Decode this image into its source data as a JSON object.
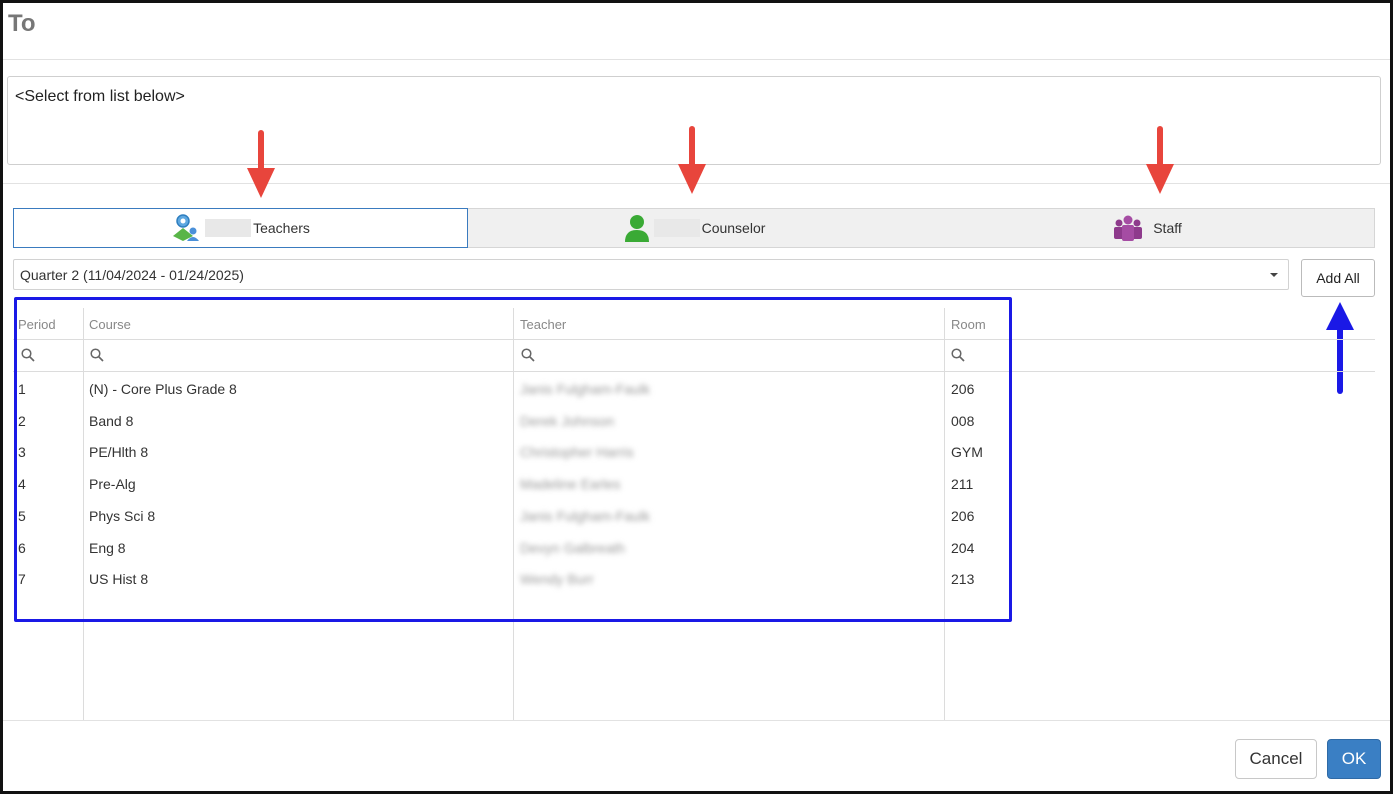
{
  "dialog": {
    "title": "To",
    "recipients_placeholder": "<Select from list below>"
  },
  "tabs": [
    {
      "label": "Teachers",
      "icon": "teachers-icon",
      "active": true
    },
    {
      "label": "Counselor",
      "icon": "counselor-icon",
      "active": false
    },
    {
      "label": "Staff",
      "icon": "staff-icon",
      "active": false
    }
  ],
  "term_select": {
    "value": "Quarter 2 (11/04/2024 - 01/24/2025)"
  },
  "add_all_label": "Add All",
  "table": {
    "columns": [
      "Period",
      "Course",
      "Teacher",
      "Room"
    ],
    "rows": [
      {
        "period": "1",
        "course": "(N) - Core Plus Grade 8",
        "teacher": "Janis Fulgham-Faulk",
        "room": "206"
      },
      {
        "period": "2",
        "course": "Band 8",
        "teacher": "Derek Johnson",
        "room": "008"
      },
      {
        "period": "3",
        "course": "PE/Hlth 8",
        "teacher": "Christopher Harris",
        "room": "GYM"
      },
      {
        "period": "4",
        "course": "Pre-Alg",
        "teacher": "Madeline Earles",
        "room": "211"
      },
      {
        "period": "5",
        "course": "Phys Sci 8",
        "teacher": "Janis Fulgham-Faulk",
        "room": "206"
      },
      {
        "period": "6",
        "course": "Eng 8",
        "teacher": "Devyn Galbreath",
        "room": "204"
      },
      {
        "period": "7",
        "course": "US Hist 8",
        "teacher": "Wendy Burr",
        "room": "213"
      }
    ]
  },
  "footer": {
    "cancel_label": "Cancel",
    "ok_label": "OK"
  },
  "colors": {
    "accent": "#3a7fc4",
    "annotation_red": "#e8453c",
    "annotation_blue": "#1a19e6"
  }
}
